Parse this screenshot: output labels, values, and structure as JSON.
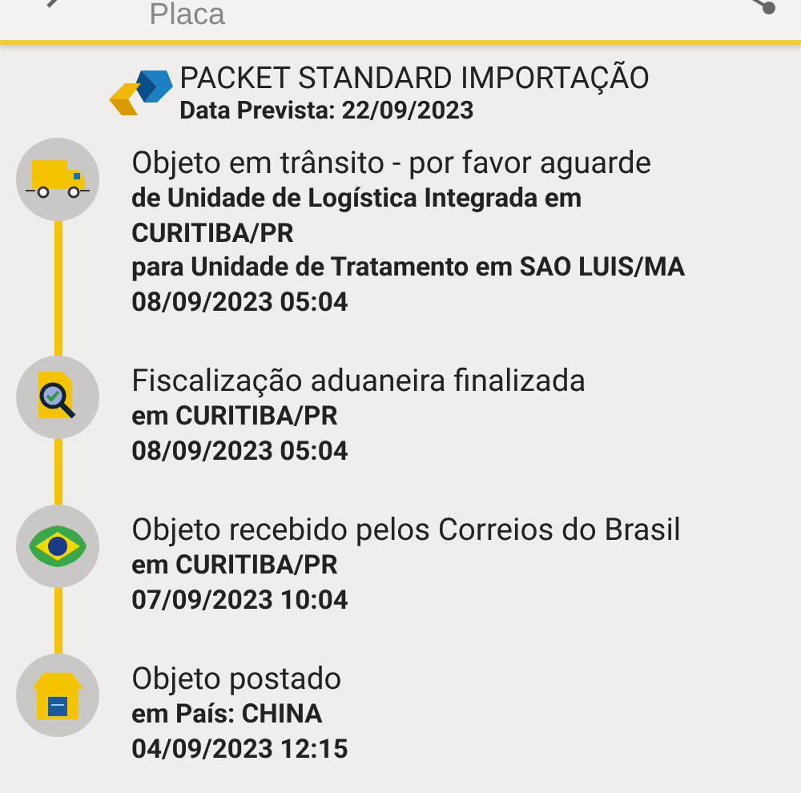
{
  "search": {
    "placeholder": "Placa"
  },
  "service": {
    "name": "PACKET STANDARD IMPORTAÇÃO",
    "forecast": "Data Prevista: 22/09/2023"
  },
  "events": [
    {
      "kind": "truck",
      "title": "Objeto em trânsito - por favor aguarde",
      "details": [
        "de Unidade de Logística Integrada em CURITIBA/PR",
        "para Unidade de Tratamento em SAO LUIS/MA",
        "08/09/2023 05:04"
      ]
    },
    {
      "kind": "inspection",
      "title": "Fiscalização aduaneira finalizada",
      "details": [
        "em CURITIBA/PR",
        "08/09/2023 05:04"
      ]
    },
    {
      "kind": "flag",
      "title": "Objeto recebido pelos Correios do Brasil",
      "details": [
        "em CURITIBA/PR",
        "07/09/2023 10:04"
      ]
    },
    {
      "kind": "house",
      "title": "Objeto postado",
      "details": [
        "em País: CHINA",
        "04/09/2023 12:15"
      ]
    }
  ]
}
